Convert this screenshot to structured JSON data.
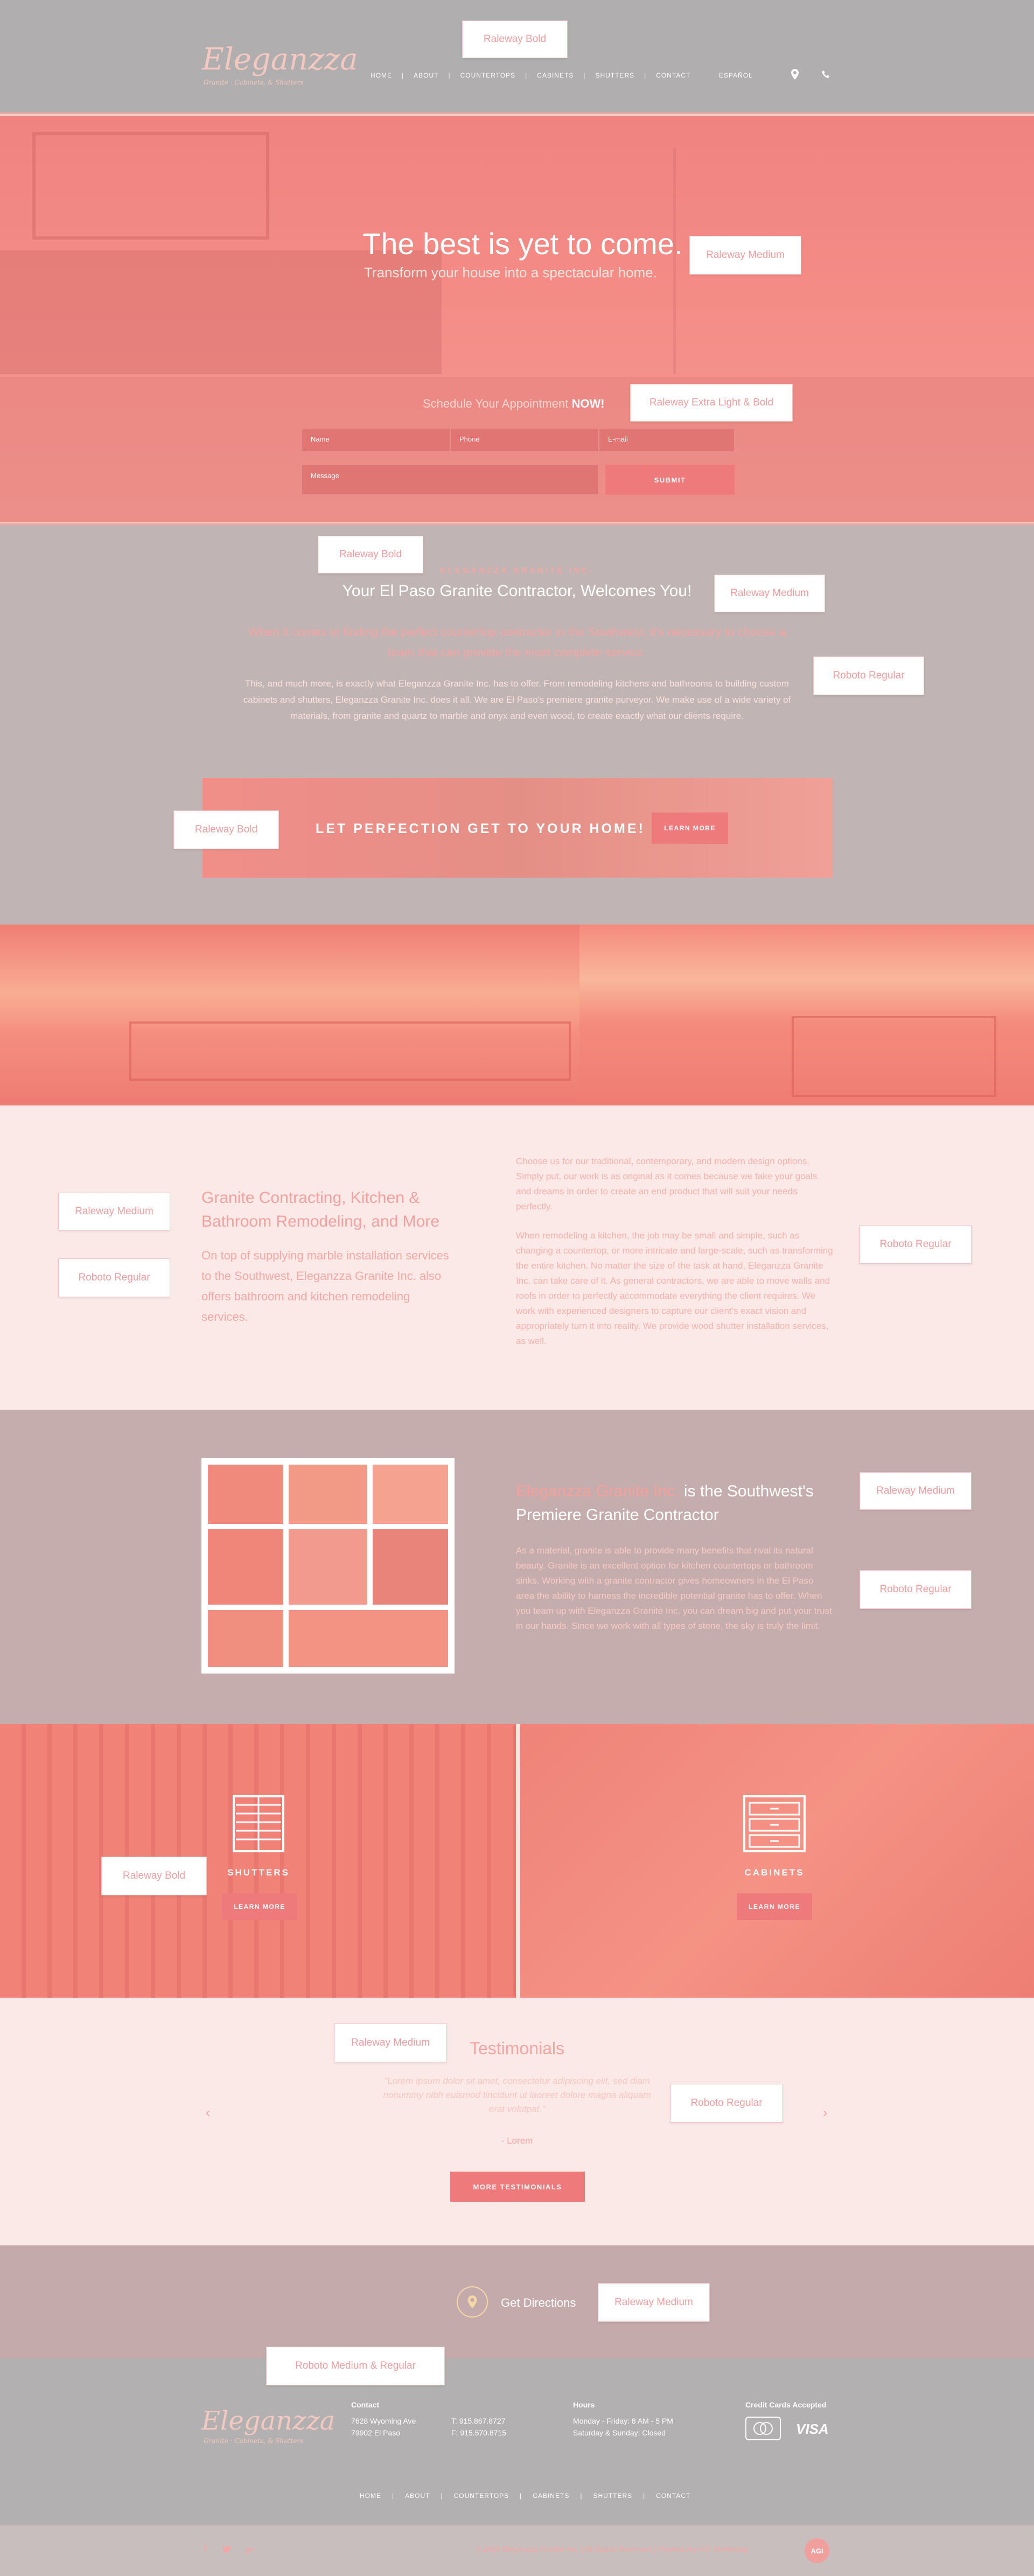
{
  "header": {
    "logo_title": "Eleganzza",
    "logo_subtitle": "Granite · Cabinets, & Shutters",
    "nav": [
      "HOME",
      "ABOUT",
      "COUNTERTOPS",
      "CABINETS",
      "SHUTTERS",
      "CONTACT"
    ],
    "language": "ESPAÑOL",
    "note": "Raleway Bold"
  },
  "hero": {
    "headline": "The best is yet to come.",
    "subheadline": "Transform your house into a spectacular home.",
    "note_headline": "Raleway Medium",
    "schedule_text": "Schedule Your Appointment",
    "schedule_now": "NOW!",
    "note_schedule": "Raleway Extra Light & Bold",
    "form": {
      "name_placeholder": "Name",
      "phone_placeholder": "Phone",
      "email_placeholder": "E-mail",
      "message_placeholder": "Message",
      "submit": "SUBMIT"
    }
  },
  "welcome": {
    "eyebrow": "ELEGANZZA GRANITE INC.",
    "title": "Your El Paso Granite Contractor, Welcomes You!",
    "lead": "When it comes to finding the perfect countertop contractor in the Southwest, it's necessary to choose a team that can provide the most complete service.",
    "body": "This, and much more, is exactly what Eleganzza Granite Inc. has to offer. From remodeling kitchens and bathrooms to building custom cabinets and shutters, Eleganzza Granite Inc. does it all. We are El Paso's premiere granite purveyor. We make use of a wide variety of materials, from granite and quartz to marble and onyx and even wood, to create exactly what our clients require.",
    "note_eyebrow": "Raleway Bold",
    "note_title": "Raleway Medium",
    "note_body": "Roboto Regular",
    "banner_text": "LET PERFECTION GET TO YOUR HOME!",
    "banner_button": "LEARN MORE",
    "note_banner": "Raleway Bold"
  },
  "contract": {
    "title": "Granite Contracting, Kitchen & Bathroom Remodeling, and More",
    "lead": "On top of supplying marble installation services to the Southwest, Eleganzza Granite Inc. also offers bathroom and kitchen remodeling services.",
    "para1": "Choose us for our traditional, contemporary, and modern design options. Simply put, our work is as original as it comes because we take your goals and dreams in order to create an end product that will suit your needs perfectly.",
    "para2": "When remodeling a kitchen, the job may be small and simple, such as changing a countertop, or more intricate and large-scale, such as transforming the entire kitchen. No matter the size of the task at hand, Eleganzza Granite Inc. can take care of it. As general contractors, we are able to move walls and roofs in order to perfectly accommodate everything the client requires. We work with experienced designers to capture our client's exact vision and appropriately turn it into reality. We provide wood shutter installation services, as well.",
    "note_title": "Raleway Medium",
    "note_lead": "Roboto Regular",
    "note_body": "Roboto Regular"
  },
  "premier": {
    "title_highlight": "Eleganzza Granite Inc.",
    "title_rest": "is the Southwest's Premiere Granite Contractor",
    "body": "As a material, granite is able to provide many benefits that rival its natural beauty. Granite is an excellent option for kitchen countertops or bathroom sinks. Working with a granite contractor gives homeowners in the El Paso area the ability to harness the incredible potential granite has to offer. When you team up with Eleganzza Granite Inc. you can dream big and put your trust in our hands. Since we work with all types of stone, the sky is truly the limit.",
    "note_title": "Raleway Medium",
    "note_body": "Roboto Regular"
  },
  "services": {
    "shutters_label": "SHUTTERS",
    "shutters_button": "LEARN MORE",
    "cabinets_label": "CABINETS",
    "cabinets_button": "LEARN MORE",
    "note": "Raleway Bold"
  },
  "testimonials": {
    "title": "Testimonials",
    "quote": "\"Lorem ipsum dolor sit amet, consectetur adipiscing elit, sed diam nonummy nibh euismod tincidunt ut laoreet dolore magna aliquam erat volutpat.\"",
    "author": "- Lorem",
    "button": "MORE TESTIMONIALS",
    "note_title": "Raleway Medium",
    "note_quote": "Roboto Regular"
  },
  "directions": {
    "label": "Get Directions",
    "note": "Raleway Medium"
  },
  "footer": {
    "note": "Roboto Medium & Regular",
    "contact_heading": "Contact",
    "address_line1": "7628 Wyoming Ave",
    "address_line2": "79902 El Paso",
    "phone": "T: 915.867.8727",
    "fax": "F: 915.570.8715",
    "hours_heading": "Hours",
    "hours_line1": "Monday - Friday: 8 AM - 5 PM",
    "hours_line2": "Saturday & Sunday: Closed",
    "cards_heading": "Credit Cards Accepted",
    "card_mastercard": "MasterCard",
    "card_visa": "VISA",
    "nav": [
      "HOME",
      "ABOUT",
      "COUNTERTOPS",
      "CABINETS",
      "SHUTTERS",
      "CONTACT"
    ],
    "copyright": "© 2018 Eleganzza Granite Inc.  |  All Rights Reserved  |  Powered by AGI Marketing",
    "agi_badge": "AGI"
  },
  "colors": {
    "accent": "#ef7a7c",
    "header_bg": "#b0aeae",
    "pink_light": "#fbe9e7"
  }
}
